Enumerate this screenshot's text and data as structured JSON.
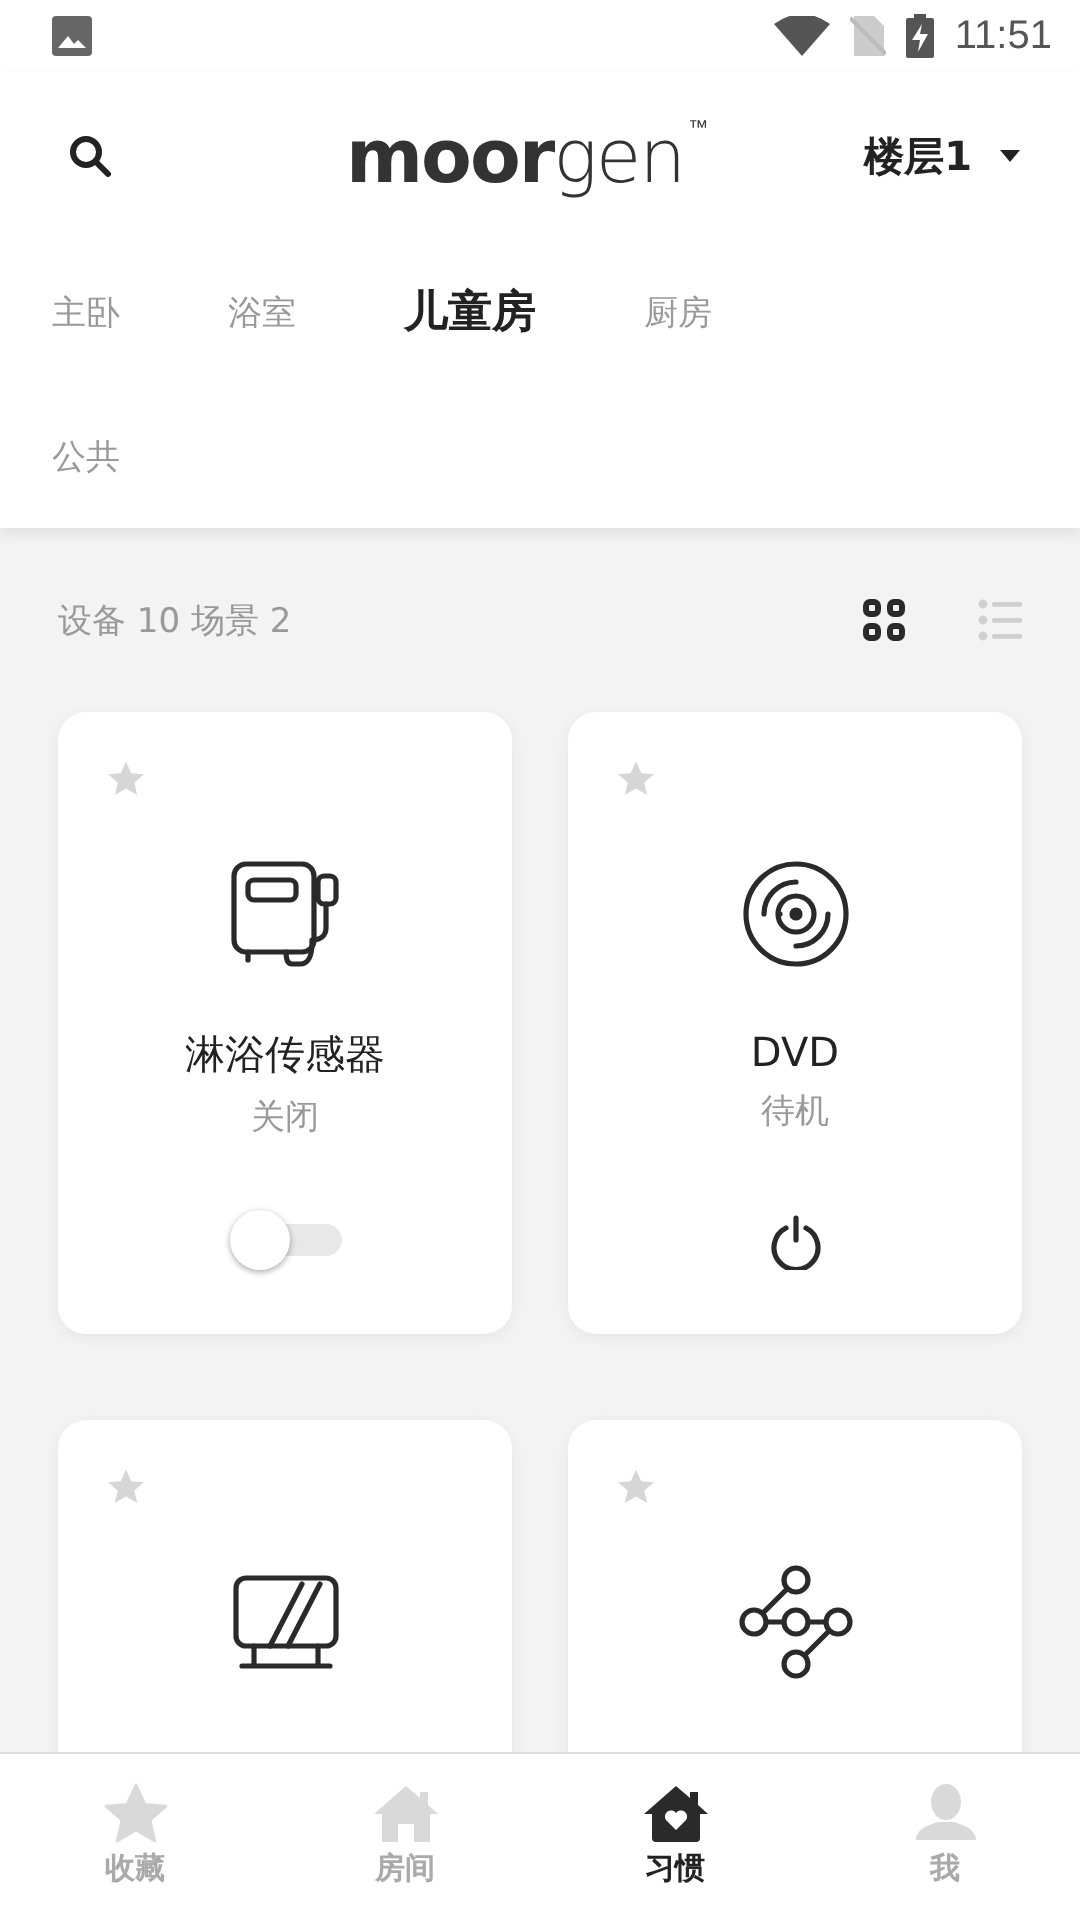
{
  "status_bar": {
    "time": "11:51"
  },
  "header": {
    "logo": "**moor**gen$^{™}$",
    "floor": "楼层1"
  },
  "rooms": [
    {
      "label": "主卧",
      "selected": false
    },
    {
      "label": "浴室",
      "selected": false
    },
    {
      "label": "儿童房",
      "selected": true
    },
    {
      "label": "厨房",
      "selected": false
    },
    {
      "label": "公共",
      "selected": false
    }
  ],
  "summary": "设备 10 场景 2",
  "view_modes": [
    {
      "kind": "grid",
      "selected": true
    },
    {
      "kind": "list",
      "selected": false
    }
  ],
  "devices": [
    {
      "kind": "shower",
      "favorite": false,
      "name": "淋浴传感器",
      "status": "关闭",
      "control": {
        "kind": "toggle",
        "on": false
      }
    },
    {
      "kind": "dvd",
      "favorite": false,
      "name": "DVD",
      "status": "待机",
      "control": {
        "kind": "power"
      }
    },
    {
      "kind": "tv",
      "favorite": false
    },
    {
      "kind": "matrix",
      "favorite": false
    }
  ],
  "bottom_nav": [
    {
      "kind": "star",
      "label": "收藏",
      "selected": false
    },
    {
      "kind": "house",
      "label": "房间",
      "selected": false
    },
    {
      "kind": "habit",
      "label": "习惯",
      "selected": true
    },
    {
      "kind": "person",
      "label": "我",
      "selected": false
    }
  ]
}
